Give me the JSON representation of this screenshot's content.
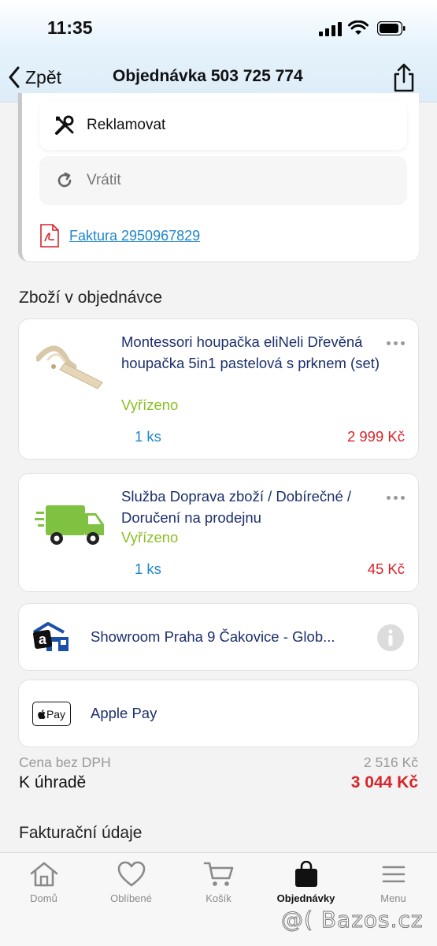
{
  "status_bar": {
    "time": "11:35"
  },
  "nav": {
    "back_label": "Zpět",
    "title": "Objednávka 503 725 774"
  },
  "actions": {
    "reklamovat": "Reklamovat",
    "vratit": "Vrátit",
    "invoice": "Faktura 2950967829"
  },
  "items_section": {
    "title": "Zboží v objednávce"
  },
  "items": [
    {
      "name": "Montessori houpačka eliNeli Dřevěná houpačka 5in1 pastelová s prknem (set)",
      "status": "Vyřízeno",
      "qty": "1 ks",
      "price": "2 999 Kč",
      "icon": "wooden-swing-image"
    },
    {
      "name": "Služba Doprava zboží / Dobírečné / Doručení na prodejnu",
      "status": "Vyřízeno",
      "qty": "1 ks",
      "price": "45 Kč",
      "icon": "delivery-truck-icon"
    }
  ],
  "delivery": {
    "label": "Showroom Praha 9 Čakovice - Glob...",
    "icon": "alza-store-logo"
  },
  "payment": {
    "label": "Apple Pay",
    "badge": "Pay"
  },
  "summary": {
    "without_vat_label": "Cena bez DPH",
    "without_vat_value": "2 516 Kč",
    "total_label": "K úhradě",
    "total_value": "3 044 Kč"
  },
  "billing_section": {
    "title": "Fakturační údaje"
  },
  "tabs": [
    {
      "label": "Domů",
      "icon": "home-icon"
    },
    {
      "label": "Oblíbené",
      "icon": "heart-icon"
    },
    {
      "label": "Košík",
      "icon": "cart-icon"
    },
    {
      "label": "Objednávky",
      "icon": "bag-icon",
      "active": true
    },
    {
      "label": "Menu",
      "icon": "menu-icon"
    }
  ],
  "watermark": "@( Bazos.cz",
  "colors": {
    "accent_blue": "#1f86c8",
    "price_red": "#d8232a",
    "status_green": "#8cbf26",
    "title_navy": "#1c2f6b"
  }
}
